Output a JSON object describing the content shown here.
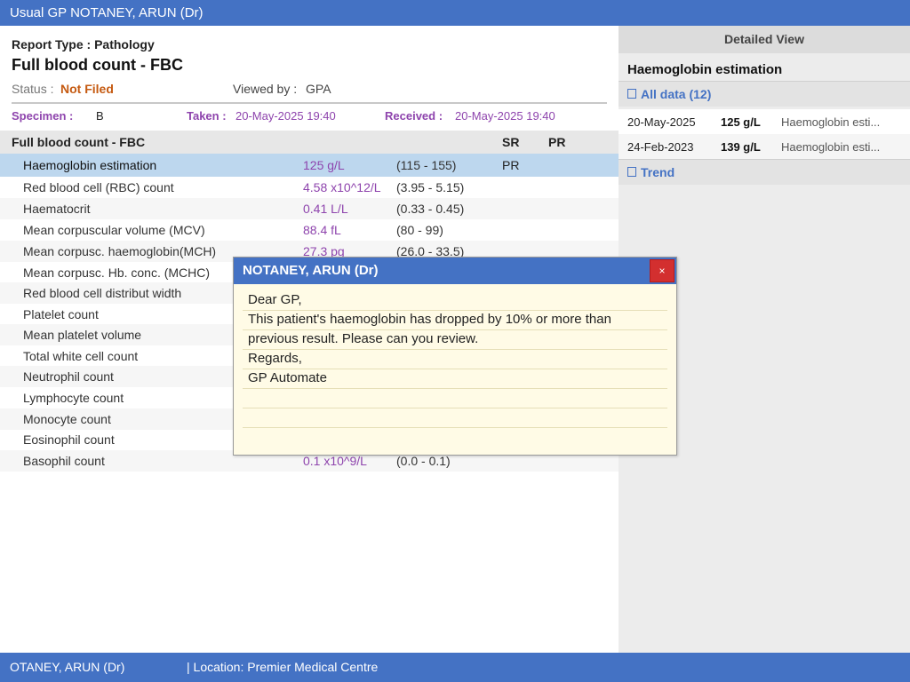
{
  "window": {
    "title": "Usual GP NOTANEY, ARUN (Dr)"
  },
  "report": {
    "type": "Report Type : Pathology",
    "title": "Full blood count - FBC",
    "status_label": "Status :",
    "status_value": "Not Filed",
    "viewed_label": "Viewed by :",
    "viewed_value": "GPA",
    "specimen_label": "Specimen :",
    "specimen_value": "B",
    "taken_label": "Taken :",
    "taken_value": "20-May-2025 19:40",
    "received_label": "Received :",
    "received_value": "20-May-2025 19:40"
  },
  "table": {
    "header": {
      "name": "Full blood count - FBC",
      "sr": "SR",
      "pr": "PR"
    },
    "rows": [
      {
        "name": "Haemoglobin estimation",
        "value": "125 g/L",
        "range": "(115 - 155)",
        "sr": "PR"
      },
      {
        "name": "Red blood cell (RBC) count",
        "value": "4.58 x10^12/L",
        "range": "(3.95 - 5.15)",
        "sr": ""
      },
      {
        "name": "Haematocrit",
        "value": "0.41 L/L",
        "range": "(0.33 - 0.45)",
        "sr": ""
      },
      {
        "name": "Mean corpuscular volume (MCV)",
        "value": "88.4 fL",
        "range": "(80 - 99)",
        "sr": ""
      },
      {
        "name": "Mean corpusc. haemoglobin(MCH)",
        "value": "27.3 pg",
        "range": "(26.0 - 33.5)",
        "sr": ""
      },
      {
        "name": "Mean corpusc. Hb. conc. (MCHC)",
        "value": "",
        "range": "",
        "sr": ""
      },
      {
        "name": "Red blood cell distribut width",
        "value": "",
        "range": "",
        "sr": ""
      },
      {
        "name": "Platelet count",
        "value": "",
        "range": "",
        "sr": ""
      },
      {
        "name": "Mean platelet volume",
        "value": "",
        "range": "",
        "sr": ""
      },
      {
        "name": "Total white cell count",
        "value": "",
        "range": "",
        "sr": ""
      },
      {
        "name": "Neutrophil count",
        "value": "",
        "range": "",
        "sr": ""
      },
      {
        "name": "Lymphocyte count",
        "value": "",
        "range": "",
        "sr": ""
      },
      {
        "name": "Monocyte count",
        "value": "",
        "range": "",
        "sr": ""
      },
      {
        "name": "Eosinophil count",
        "value": "",
        "range": "",
        "sr": ""
      },
      {
        "name": "Basophil count",
        "value": "0.1 x10^9/L",
        "range": "(0.0 - 0.1)",
        "sr": ""
      }
    ]
  },
  "detail": {
    "heading": "Detailed View",
    "title": "Haemoglobin estimation",
    "all_data_label": "All data (12)",
    "entries": [
      {
        "date": "20-May-2025",
        "value": "125 g/L",
        "name": "Haemoglobin esti..."
      },
      {
        "date": "24-Feb-2023",
        "value": "139 g/L",
        "name": "Haemoglobin esti..."
      }
    ],
    "trend_label": "Trend"
  },
  "popup": {
    "title": "NOTANEY, ARUN (Dr)",
    "close_icon": "×",
    "lines": [
      "Dear GP,",
      "This patient's haemoglobin has dropped by 10% or more than",
      "previous result. Please can you review.",
      "Regards,",
      "GP Automate",
      "",
      "",
      ""
    ]
  },
  "statusbar": {
    "clinician": "OTANEY, ARUN (Dr)",
    "location": "| Location: Premier Medical Centre"
  },
  "colors": {
    "accent": "#4472c4",
    "value_purple": "#8e44ad",
    "status_orange": "#c55a11",
    "selected_row": "#bdd7ee",
    "note_background": "#fffbe6",
    "close_red": "#d32f2f"
  }
}
